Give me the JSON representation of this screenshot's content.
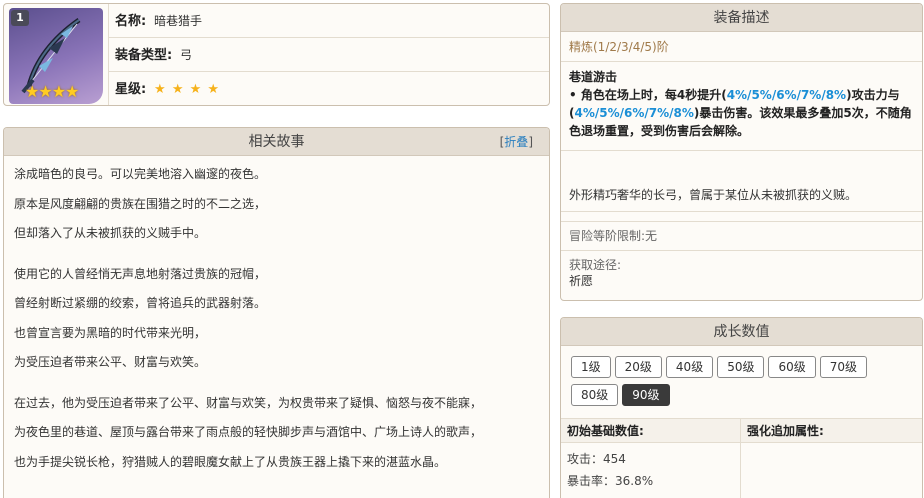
{
  "item": {
    "level_badge": "1",
    "name_label": "名称:",
    "name_value": "暗巷猎手",
    "type_label": "装备类型:",
    "type_value": "弓",
    "rarity_label": "星级:",
    "rarity_count": 4,
    "item_star_glyphs": "★★★★",
    "rarity_star_glyphs": "★ ★ ★ ★",
    "colors": {
      "image_bg": "#7b68b0",
      "star": "#f6b21b"
    }
  },
  "story": {
    "title": "相关故事",
    "fold_open": "[",
    "fold_label": "折叠",
    "fold_close": "]",
    "paragraphs": [
      [
        "涂成暗色的良弓。可以完美地溶入幽邃的夜色。",
        "原本是风度翩翩的贵族在围猎之时的不二之选，",
        "但却落入了从未被抓获的义贼手中。"
      ],
      [
        "使用它的人曾经悄无声息地射落过贵族的冠帽，",
        "曾经射断过紧绷的绞索，曾将追兵的武器射落。",
        "也曾宣言要为黑暗的时代带来光明，",
        "为受压迫者带来公平、财富与欢笑。"
      ],
      [
        "在过去，他为受压迫者带来了公平、财富与欢笑，为权贵带来了疑惧、恼怒与夜不能寐，",
        "为夜色里的巷道、屋顶与露台带来了雨点般的轻快脚步声与酒馆中、广场上诗人的歌声，",
        "也为手提尖锐长枪，狩猎贼人的碧眼魔女献上了从贵族王器上撬下来的湛蓝水晶。"
      ]
    ]
  },
  "description": {
    "title": "装备描述",
    "refinement": "精炼(1/2/3/4/5)阶",
    "skill_name": "巷道游击",
    "skill_p1": "• 角色在场上时，每4秒提升(",
    "skill_v1": "4%/5%/6%/7%/8%",
    "skill_p2": ")攻击力与(",
    "skill_v2": "4%/5%/6%/7%/8%",
    "skill_p3": ")暴击伤害。该效果最多叠加5次，不随角色退场重置，受到伤害后会解除。",
    "flavor": "外形精巧奢华的长弓，曾属于某位从未被抓获的义贼。",
    "rank_label": "冒险等阶限制:",
    "rank_value": "无",
    "source_label": "获取途径:",
    "source_value": "祈愿",
    "highlight_color": "#1b8fd6"
  },
  "growth": {
    "title": "成长数值",
    "levels": [
      "1级",
      "20级",
      "40级",
      "50级",
      "60级",
      "70级",
      "80级",
      "90级"
    ],
    "selected_level": "90级",
    "base_header": "初始基础数值:",
    "bonus_header": "强化追加属性:",
    "stats": [
      {
        "label": "攻击：",
        "value": "454"
      },
      {
        "label": "暴击率：",
        "value": "36.8%"
      }
    ]
  }
}
